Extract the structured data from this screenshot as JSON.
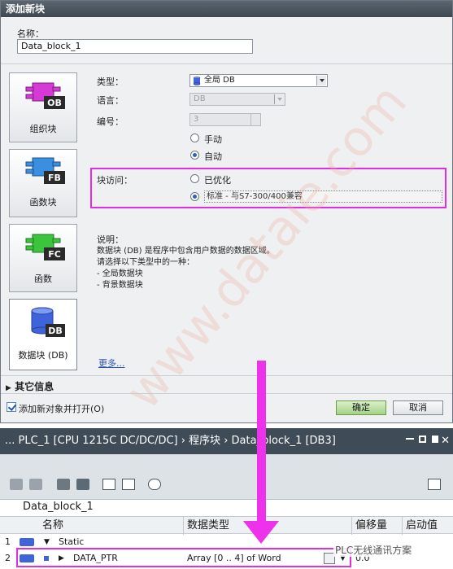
{
  "dialog": {
    "title": "添加新块",
    "name_label": "名称：",
    "name_value": "Data_block_1",
    "tiles": [
      {
        "label": "组织块",
        "badge": "OB"
      },
      {
        "label": "函数块",
        "badge": "FB"
      },
      {
        "label": "函数",
        "badge": "FC"
      },
      {
        "label": "数据块 (DB)",
        "badge": "DB"
      }
    ],
    "type_label": "类型：",
    "type_value": "全局 DB",
    "language_label": "语言：",
    "language_value": "DB",
    "number_label": "编号：",
    "number_value": "3",
    "manual_label": "手动",
    "auto_label": "自动",
    "access_label": "块访问：",
    "optimized_label": "已优化",
    "standard_label": "标准 - 与S7-300/400兼容",
    "desc_title": "说明：",
    "desc_text": "数据块 (DB) 是程序中包含用户数据的数据区域。\n请选择以下类型中的一种：\n- 全局数据块\n- 背景数据块",
    "more_link": "更多...",
    "other_info": "其它信息",
    "add_open_label": "添加新对象并打开(O)",
    "ok_label": "确定",
    "cancel_label": "取消",
    "watermark": "www.dataie.com"
  },
  "editor": {
    "title": "... PLC_1 [CPU 1215C DC/DC/DC] › 程序块 › Data_block_1 [DB3]",
    "block_name": "Data_block_1",
    "columns": [
      "名称",
      "数据类型",
      "偏移量",
      "启动值"
    ],
    "rows": [
      {
        "num": "1",
        "name": "Static",
        "type": "",
        "offset": ""
      },
      {
        "num": "2",
        "name": "DATA_PTR",
        "type": "Array [0 .. 4] of Word",
        "offset": "0.0"
      }
    ],
    "wechat_label": "PLC无线通讯方案"
  },
  "colors": {
    "highlight": "#e22de0",
    "arrow": "#ee32ec",
    "titlebar": "#3f4b57"
  }
}
